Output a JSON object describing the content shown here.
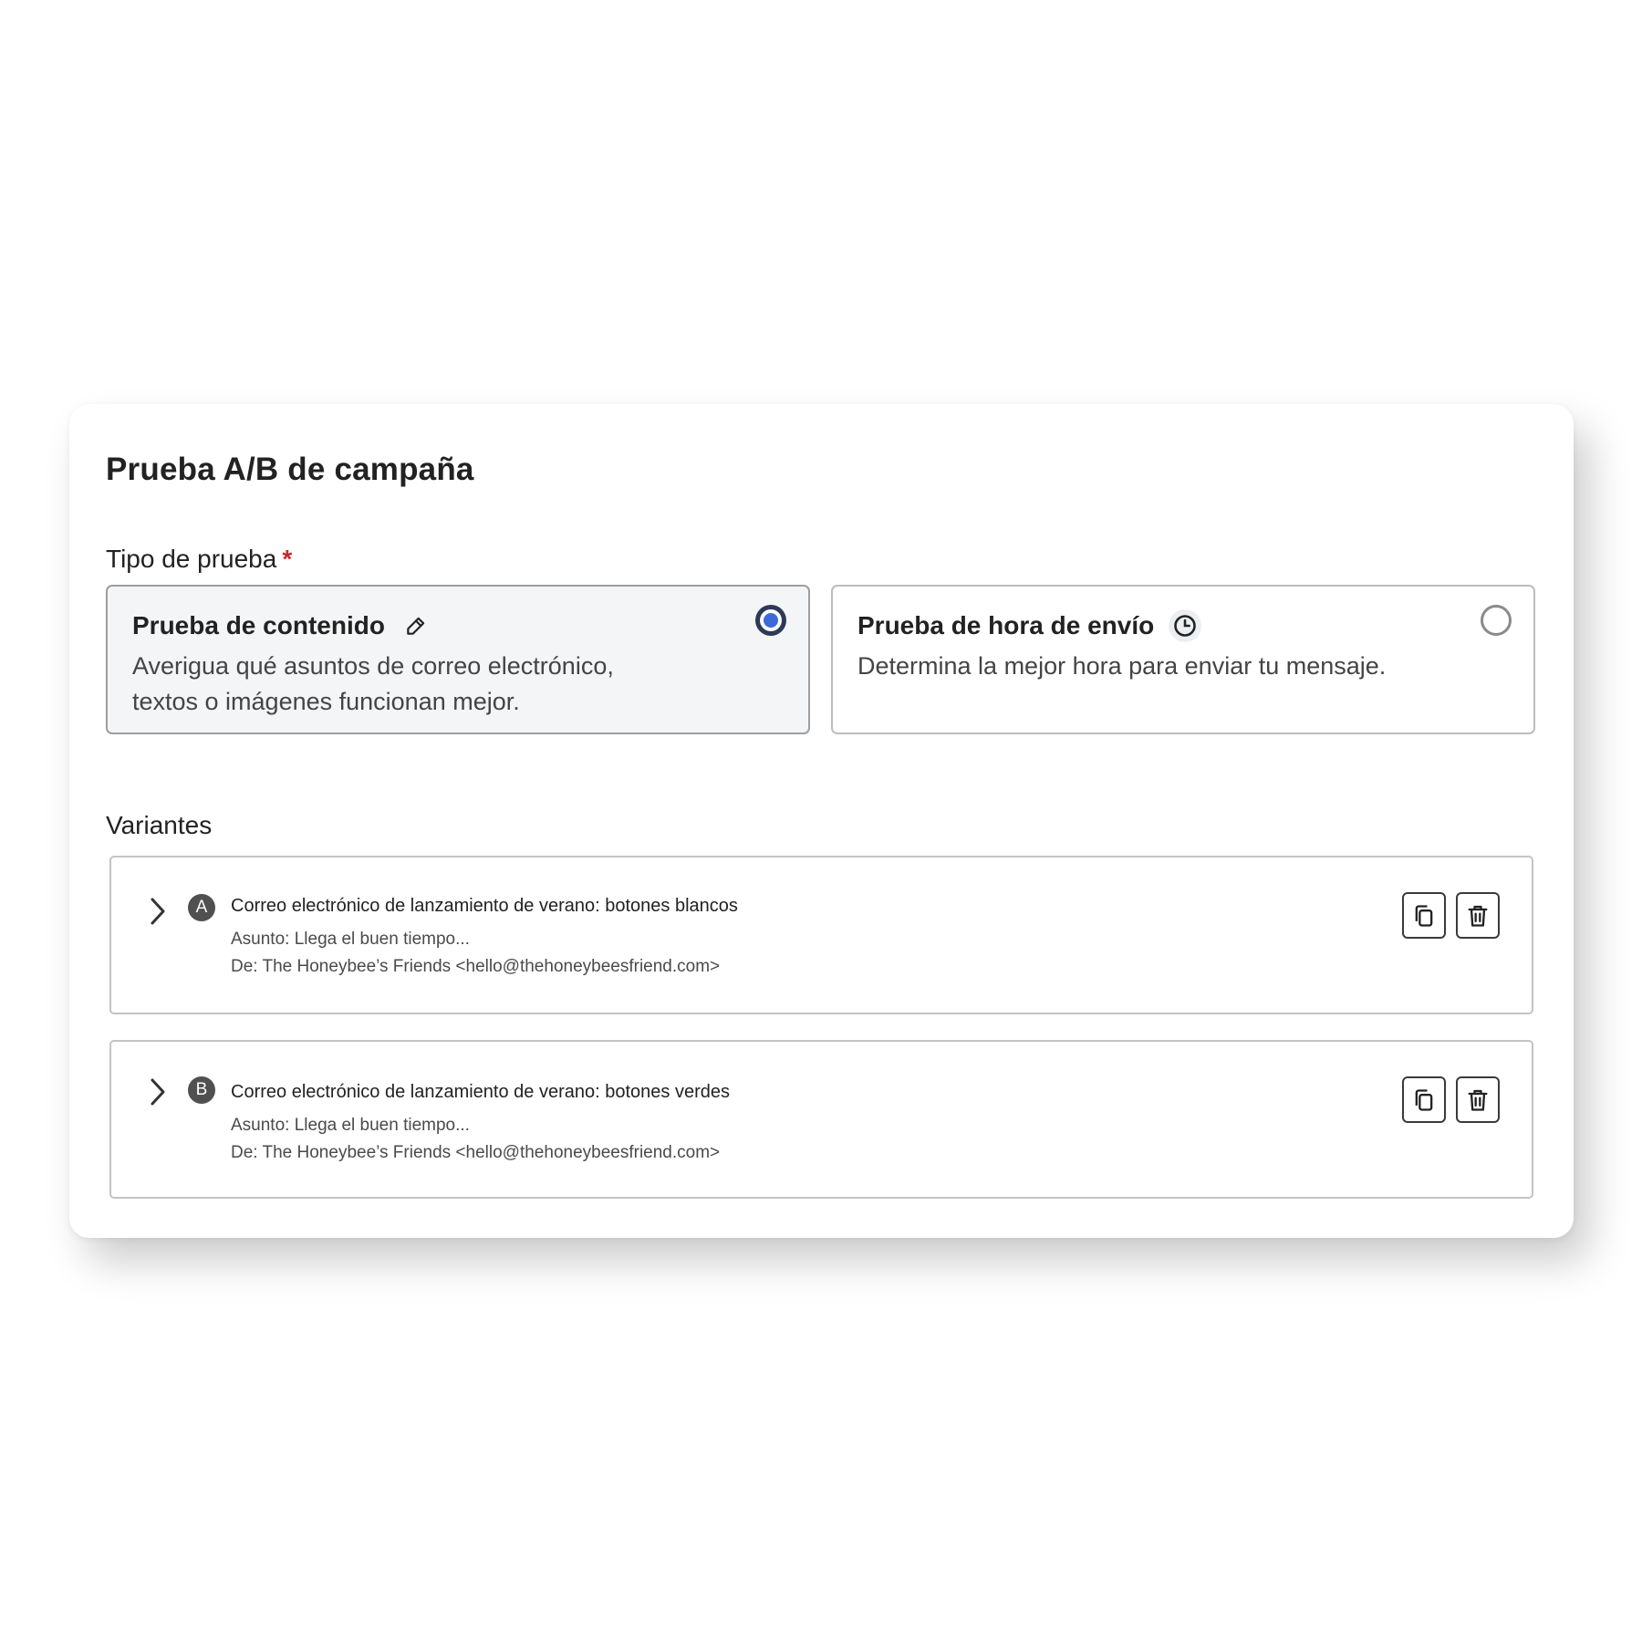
{
  "page": {
    "title": "Prueba A/B de campaña"
  },
  "test_type": {
    "label": "Tipo de prueba",
    "required_marker": "*",
    "options": [
      {
        "title": "Prueba de contenido",
        "description": "Averigua qué asuntos de correo electrónico, textos o imágenes funcionan mejor.",
        "icon": "pencil-icon",
        "selected": true
      },
      {
        "title": "Prueba de hora de envío",
        "description": "Determina la mejor hora para enviar tu mensaje.",
        "icon": "clock-icon",
        "selected": false
      }
    ]
  },
  "variants": {
    "label": "Variantes",
    "items": [
      {
        "letter": "A",
        "name": "Correo electrónico de lanzamiento de verano: botones blancos",
        "subject": "Asunto: Llega el buen tiempo...",
        "from": "De: The Honeybee’s Friends <hello@thehoneybeesfriend.com>"
      },
      {
        "letter": "B",
        "name": "Correo electrónico de lanzamiento de verano: botones verdes",
        "subject": "Asunto: Llega el buen tiempo...",
        "from": "De: The Honeybee’s Friends <hello@thehoneybeesfriend.com>"
      }
    ]
  },
  "colors": {
    "radio_selected": "#3d6ad6",
    "required": "#c62828",
    "selected_card_bg": "#f3f5f7"
  }
}
